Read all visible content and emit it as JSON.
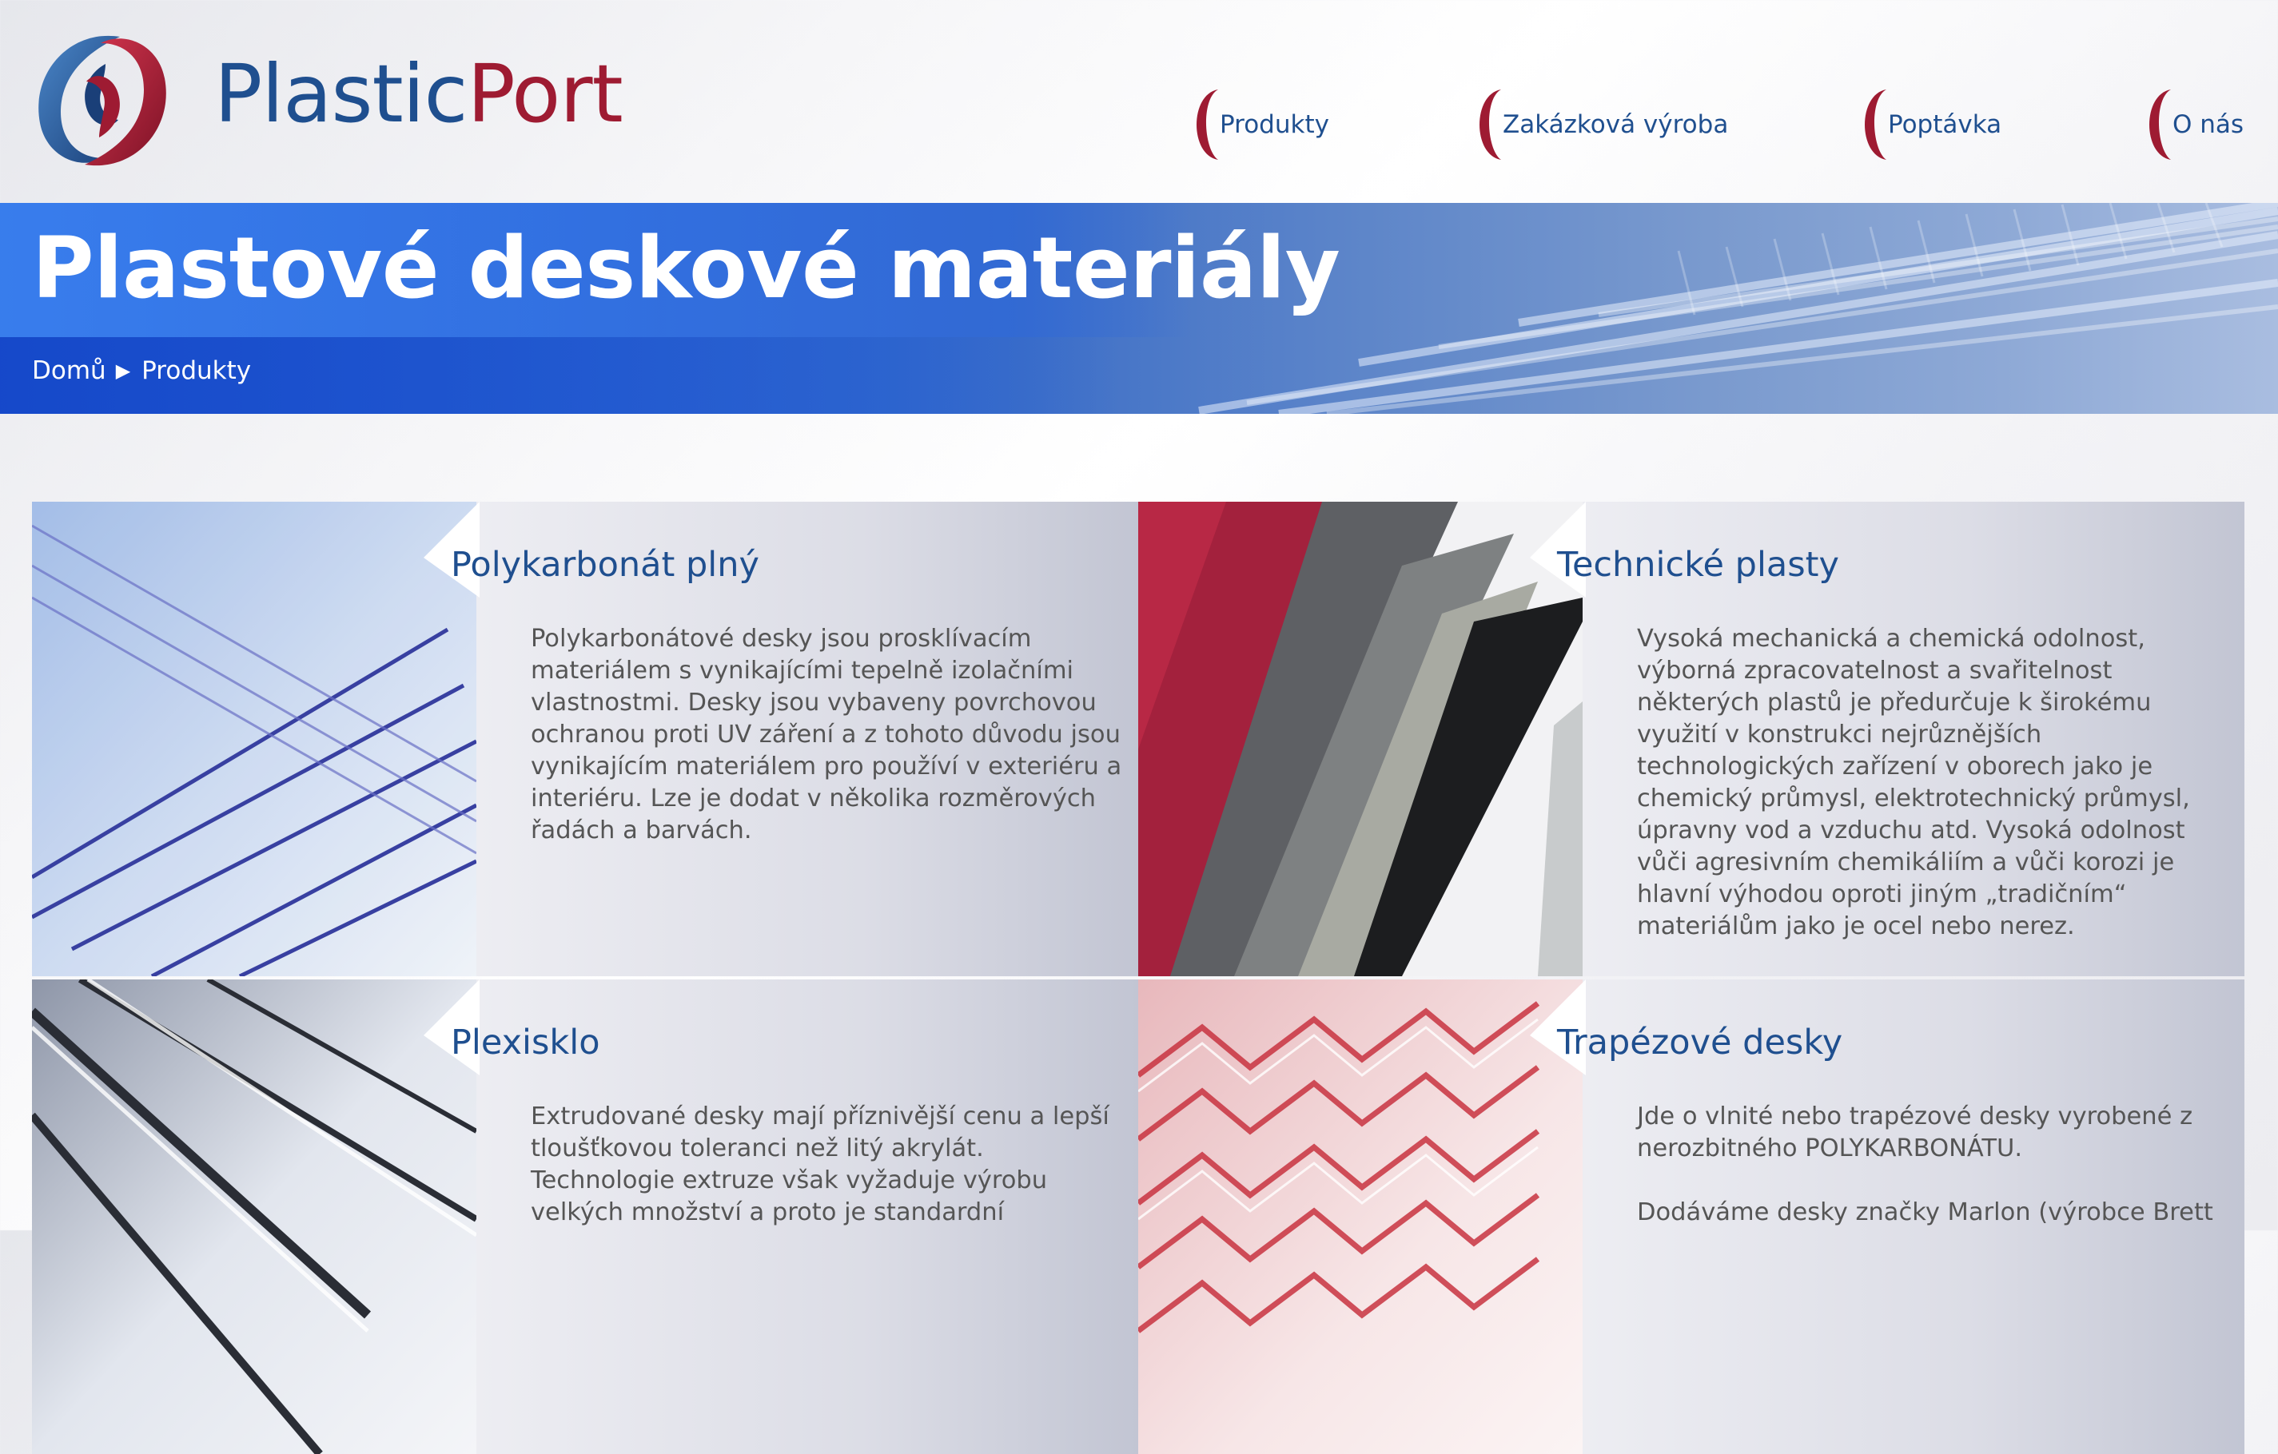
{
  "brand": {
    "part1": "Plastic",
    "part2": "Port",
    "logo_icon": "plasticport-logo",
    "colors": {
      "blue": "#1f4f8f",
      "red": "#9e1b32"
    }
  },
  "nav": [
    {
      "label": "Produkty"
    },
    {
      "label": "Zakázková výroba"
    },
    {
      "label": "Poptávka"
    },
    {
      "label": "O nás"
    }
  ],
  "banner": {
    "title": "Plastové deskové materiály"
  },
  "breadcrumb": {
    "home": "Domů",
    "separator_icon": "triangle-right-icon",
    "current": "Produkty"
  },
  "products": [
    {
      "title": "Polykarbonát plný",
      "paragraphs": [
        "Polykarbonátové desky jsou prosklívacím materiálem s vynikajícími tepelně izolačními vlastnostmi. Desky jsou vybaveny povrchovou ochranou proti UV záření a z tohoto důvodu jsou vynikajícím materiálem pro používí v exteriéru a interiéru. Lze je dodat v několika rozměrových řadách a barvách."
      ]
    },
    {
      "title": "Technické plasty",
      "paragraphs": [
        "Vysoká mechanická a chemická odolnost, výborná zpracovatelnost a svařitelnost některých plastů je předurčuje k širokému využití v konstrukci nejrůznějších technologických zařízení v oborech jako je chemický průmysl, elektrotechnický průmysl, úpravny vod a vzduchu atd. Vysoká odolnost vůči agresivním chemikáliím a vůči korozi je hlavní výhodou oproti jiným „tradičním“ materiálům jako je ocel nebo nerez."
      ]
    },
    {
      "title": "Plexisklo",
      "paragraphs": [
        "Extrudované desky mají příznivější cenu a lepší tloušťkovou toleranci než litý akrylát. Technologie extruze však vyžaduje výrobu velkých množství a proto je standardní"
      ]
    },
    {
      "title": "Trapézové desky",
      "paragraphs": [
        "Jde o vlnité nebo trapézové desky vyrobené z nerozbitného POLYKARBONÁTU.",
        "Dodáváme desky značky Marlon (výrobce Brett"
      ]
    }
  ]
}
